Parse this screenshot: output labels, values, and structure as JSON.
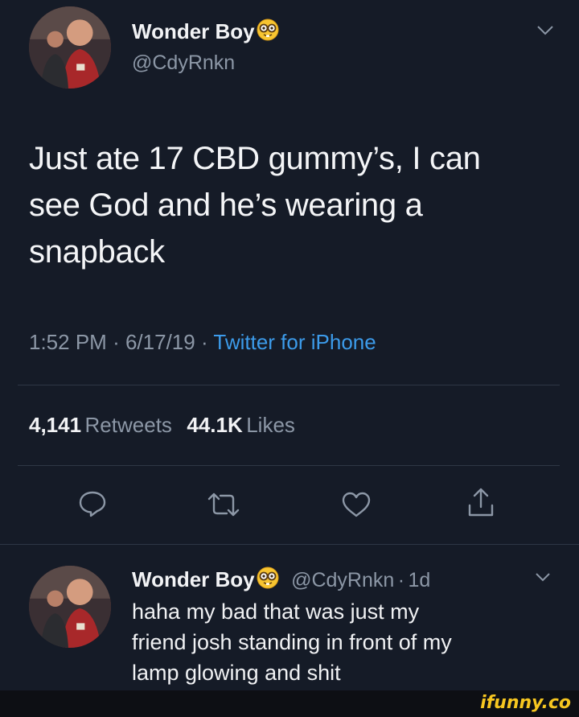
{
  "tweet": {
    "author_name": "Wonder Boy",
    "author_emoji": "nerd-face-emoji",
    "author_handle": "@CdyRnkn",
    "text_line1": "Just ate 17 CBD gummy’s, I can",
    "text_line2": "see God and he’s wearing a",
    "text_line3": "snapback",
    "time": "1:52 PM",
    "separator": "·",
    "date": "6/17/19",
    "source": "Twitter for iPhone",
    "retweets_count": "4,141",
    "retweets_label": "Retweets",
    "likes_count": "44.1K",
    "likes_label": "Likes"
  },
  "actions": {
    "icons": [
      "reply-icon",
      "retweet-icon",
      "like-icon",
      "share-icon"
    ]
  },
  "reply": {
    "author_name": "Wonder Boy",
    "author_emoji": "nerd-face-emoji",
    "author_handle": "@CdyRnkn",
    "separator": "·",
    "age": "1d",
    "text_line1": "haha my bad that was just my",
    "text_line2": "friend josh standing in front of my",
    "text_line3": "lamp glowing and shit"
  },
  "watermark": "ifunny.co",
  "colors": {
    "background": "#151b27",
    "link": "#3c9bea",
    "muted": "#8c97a6",
    "watermark": "#f6c620"
  }
}
